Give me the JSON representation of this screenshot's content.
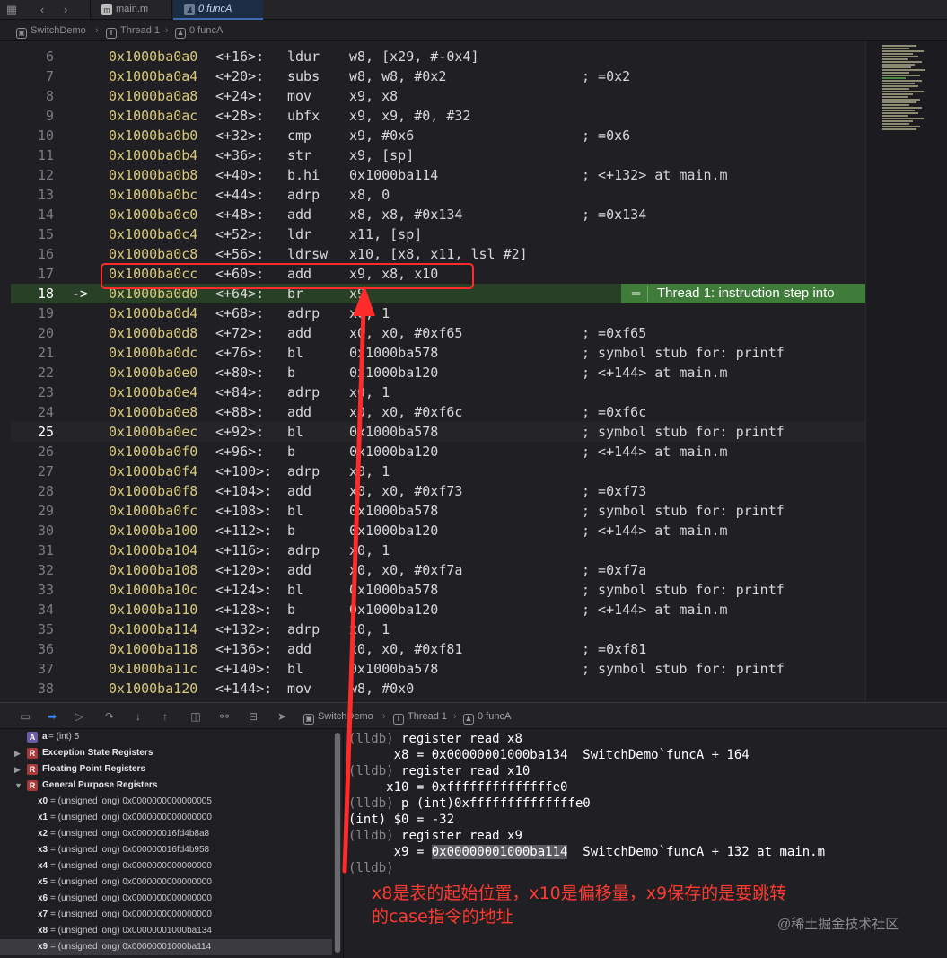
{
  "tabbar": {
    "tabs": [
      {
        "label": "main.m",
        "icon": "objc-file-icon",
        "icon_text": "m",
        "active": false
      },
      {
        "label": "0 funcA",
        "icon": "person-icon",
        "icon_text": "",
        "active": true
      }
    ]
  },
  "jumpbar": {
    "items": [
      {
        "label": "SwitchDemo",
        "icon": "app-icon"
      },
      {
        "label": "Thread 1",
        "icon": "thread-icon"
      },
      {
        "label": "0 funcA",
        "icon": "person-icon"
      }
    ]
  },
  "code": {
    "current_line": 18,
    "cursor_line": 25,
    "lines": [
      {
        "n": "6",
        "addr": "0x1000ba0a0",
        "off": "<+16>:",
        "mn": "ldur",
        "ops": "w8, [x29, #-0x4]",
        "cm": ""
      },
      {
        "n": "7",
        "addr": "0x1000ba0a4",
        "off": "<+20>:",
        "mn": "subs",
        "ops": "w8, w8, #0x2",
        "cm": "; =0x2"
      },
      {
        "n": "8",
        "addr": "0x1000ba0a8",
        "off": "<+24>:",
        "mn": "mov",
        "ops": "x9, x8",
        "cm": ""
      },
      {
        "n": "9",
        "addr": "0x1000ba0ac",
        "off": "<+28>:",
        "mn": "ubfx",
        "ops": "x9, x9, #0, #32",
        "cm": ""
      },
      {
        "n": "10",
        "addr": "0x1000ba0b0",
        "off": "<+32>:",
        "mn": "cmp",
        "ops": "x9, #0x6",
        "cm": "; =0x6"
      },
      {
        "n": "11",
        "addr": "0x1000ba0b4",
        "off": "<+36>:",
        "mn": "str",
        "ops": "x9, [sp]",
        "cm": ""
      },
      {
        "n": "12",
        "addr": "0x1000ba0b8",
        "off": "<+40>:",
        "mn": "b.hi",
        "ops": "0x1000ba114",
        "cm": "; <+132> at main.m"
      },
      {
        "n": "13",
        "addr": "0x1000ba0bc",
        "off": "<+44>:",
        "mn": "adrp",
        "ops": "x8, 0",
        "cm": ""
      },
      {
        "n": "14",
        "addr": "0x1000ba0c0",
        "off": "<+48>:",
        "mn": "add",
        "ops": "x8, x8, #0x134",
        "cm": "; =0x134"
      },
      {
        "n": "15",
        "addr": "0x1000ba0c4",
        "off": "<+52>:",
        "mn": "ldr",
        "ops": "x11, [sp]",
        "cm": ""
      },
      {
        "n": "16",
        "addr": "0x1000ba0c8",
        "off": "<+56>:",
        "mn": "ldrsw",
        "ops": "x10, [x8, x11, lsl #2]",
        "cm": ""
      },
      {
        "n": "17",
        "addr": "0x1000ba0cc",
        "off": "<+60>:",
        "mn": "add",
        "ops": "x9, x8, x10",
        "cm": ""
      },
      {
        "n": "18",
        "addr": "0x1000ba0d0",
        "off": "<+64>:",
        "mn": "br",
        "ops": "x9",
        "cm": "",
        "arrow": "->"
      },
      {
        "n": "19",
        "addr": "0x1000ba0d4",
        "off": "<+68>:",
        "mn": "adrp",
        "ops": "x0, 1",
        "cm": ""
      },
      {
        "n": "20",
        "addr": "0x1000ba0d8",
        "off": "<+72>:",
        "mn": "add",
        "ops": "x0, x0, #0xf65",
        "cm": "; =0xf65"
      },
      {
        "n": "21",
        "addr": "0x1000ba0dc",
        "off": "<+76>:",
        "mn": "bl",
        "ops": "0x1000ba578",
        "cm": "; symbol stub for: printf"
      },
      {
        "n": "22",
        "addr": "0x1000ba0e0",
        "off": "<+80>:",
        "mn": "b",
        "ops": "0x1000ba120",
        "cm": "; <+144> at main.m"
      },
      {
        "n": "23",
        "addr": "0x1000ba0e4",
        "off": "<+84>:",
        "mn": "adrp",
        "ops": "x0, 1",
        "cm": ""
      },
      {
        "n": "24",
        "addr": "0x1000ba0e8",
        "off": "<+88>:",
        "mn": "add",
        "ops": "x0, x0, #0xf6c",
        "cm": "; =0xf6c"
      },
      {
        "n": "25",
        "addr": "0x1000ba0ec",
        "off": "<+92>:",
        "mn": "bl",
        "ops": "0x1000ba578",
        "cm": "; symbol stub for: printf"
      },
      {
        "n": "26",
        "addr": "0x1000ba0f0",
        "off": "<+96>:",
        "mn": "b",
        "ops": "0x1000ba120",
        "cm": "; <+144> at main.m"
      },
      {
        "n": "27",
        "addr": "0x1000ba0f4",
        "off": "<+100>:",
        "mn": "adrp",
        "ops": "x0, 1",
        "cm": ""
      },
      {
        "n": "28",
        "addr": "0x1000ba0f8",
        "off": "<+104>:",
        "mn": "add",
        "ops": "x0, x0, #0xf73",
        "cm": "; =0xf73"
      },
      {
        "n": "29",
        "addr": "0x1000ba0fc",
        "off": "<+108>:",
        "mn": "bl",
        "ops": "0x1000ba578",
        "cm": "; symbol stub for: printf"
      },
      {
        "n": "30",
        "addr": "0x1000ba100",
        "off": "<+112>:",
        "mn": "b",
        "ops": "0x1000ba120",
        "cm": "; <+144> at main.m"
      },
      {
        "n": "31",
        "addr": "0x1000ba104",
        "off": "<+116>:",
        "mn": "adrp",
        "ops": "x0, 1",
        "cm": ""
      },
      {
        "n": "32",
        "addr": "0x1000ba108",
        "off": "<+120>:",
        "mn": "add",
        "ops": "x0, x0, #0xf7a",
        "cm": "; =0xf7a"
      },
      {
        "n": "33",
        "addr": "0x1000ba10c",
        "off": "<+124>:",
        "mn": "bl",
        "ops": "0x1000ba578",
        "cm": "; symbol stub for: printf"
      },
      {
        "n": "34",
        "addr": "0x1000ba110",
        "off": "<+128>:",
        "mn": "b",
        "ops": "0x1000ba120",
        "cm": "; <+144> at main.m"
      },
      {
        "n": "35",
        "addr": "0x1000ba114",
        "off": "<+132>:",
        "mn": "adrp",
        "ops": "x0, 1",
        "cm": ""
      },
      {
        "n": "36",
        "addr": "0x1000ba118",
        "off": "<+136>:",
        "mn": "add",
        "ops": "x0, x0, #0xf81",
        "cm": "; =0xf81"
      },
      {
        "n": "37",
        "addr": "0x1000ba11c",
        "off": "<+140>:",
        "mn": "bl",
        "ops": "0x1000ba578",
        "cm": "; symbol stub for: printf"
      },
      {
        "n": "38",
        "addr": "0x1000ba120",
        "off": "<+144>:",
        "mn": "mov",
        "ops": "w8, #0x0",
        "cm": ""
      }
    ]
  },
  "thread_badge": {
    "label": "Thread 1: instruction step into",
    "icon": "equals-icon"
  },
  "debug_bar": {
    "items": [
      {
        "label": "SwitchDemo",
        "icon": "app-icon"
      },
      {
        "label": "Thread 1",
        "icon": "thread-icon"
      },
      {
        "label": "0 funcA",
        "icon": "person-icon"
      }
    ]
  },
  "variables": {
    "rows": [
      {
        "kind": "var",
        "badge": "A",
        "name": "a",
        "value": " = (int) 5"
      },
      {
        "kind": "group",
        "badge": "R",
        "name": "Exception State Registers",
        "expanded": false
      },
      {
        "kind": "group",
        "badge": "R",
        "name": "Floating Point Registers",
        "expanded": false
      },
      {
        "kind": "group",
        "badge": "R",
        "name": "General Purpose Registers",
        "expanded": true
      },
      {
        "kind": "reg",
        "name": "x0",
        "value": " = (unsigned long) 0x0000000000000005"
      },
      {
        "kind": "reg",
        "name": "x1",
        "value": " = (unsigned long) 0x0000000000000000"
      },
      {
        "kind": "reg",
        "name": "x2",
        "value": " = (unsigned long) 0x000000016fd4b8a8"
      },
      {
        "kind": "reg",
        "name": "x3",
        "value": " = (unsigned long) 0x000000016fd4b958"
      },
      {
        "kind": "reg",
        "name": "x4",
        "value": " = (unsigned long) 0x0000000000000000"
      },
      {
        "kind": "reg",
        "name": "x5",
        "value": " = (unsigned long) 0x0000000000000000"
      },
      {
        "kind": "reg",
        "name": "x6",
        "value": " = (unsigned long) 0x0000000000000000"
      },
      {
        "kind": "reg",
        "name": "x7",
        "value": " = (unsigned long) 0x0000000000000000"
      },
      {
        "kind": "reg",
        "name": "x8",
        "value": " = (unsigned long) 0x00000001000ba134"
      },
      {
        "kind": "reg",
        "name": "x9",
        "value": " = (unsigned long) 0x00000001000ba114",
        "selected": true
      }
    ]
  },
  "console": {
    "lines": [
      {
        "prompt": "(lldb) ",
        "text": "register read x8"
      },
      {
        "prompt": "",
        "text": "      x8 = 0x00000001000ba134  SwitchDemo`funcA + 164"
      },
      {
        "prompt": "(lldb) ",
        "text": "register read x10"
      },
      {
        "prompt": "",
        "text": "     x10 = 0xffffffffffffffe0"
      },
      {
        "prompt": "(lldb) ",
        "text": "p (int)0xffffffffffffffe0"
      },
      {
        "prompt": "",
        "text": "(int) $0 = -32"
      },
      {
        "prompt": "(lldb) ",
        "text": "register read x9"
      },
      {
        "prompt": "",
        "pre": "      x9 = ",
        "sel": "0x00000001000ba114",
        "text": "  SwitchDemo`funcA + 132 at main.m"
      },
      {
        "prompt": "(lldb)",
        "text": ""
      }
    ]
  },
  "annotation": {
    "line1": "x8是表的起始位置，x10是偏移量，x9保存的是要跳转",
    "line2": "的case指令的地址"
  },
  "watermark": "@稀土掘金技术社区",
  "colors": {
    "highlight_line": "#284025",
    "thread_badge": "#3f7c3a",
    "address": "#d9c97c",
    "annotation_red": "#ff3b30"
  }
}
